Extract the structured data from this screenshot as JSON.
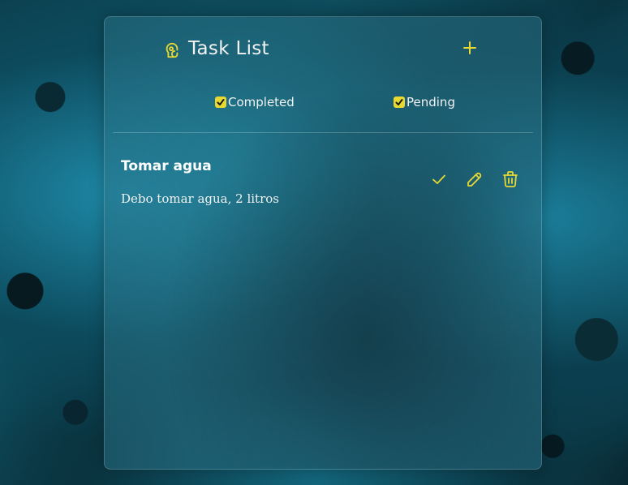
{
  "app": {
    "title": "Task List",
    "accent_color": "#e8d930"
  },
  "header": {
    "logo_icon": "brain-head-icon",
    "add_icon": "plus-icon"
  },
  "filters": [
    {
      "label": "Completed",
      "checked": true
    },
    {
      "label": "Pending",
      "checked": true
    }
  ],
  "tasks": [
    {
      "title": "Tomar agua",
      "description": "Debo tomar agua, 2 litros",
      "actions": [
        "check-icon",
        "pencil-icon",
        "trash-icon"
      ]
    }
  ]
}
